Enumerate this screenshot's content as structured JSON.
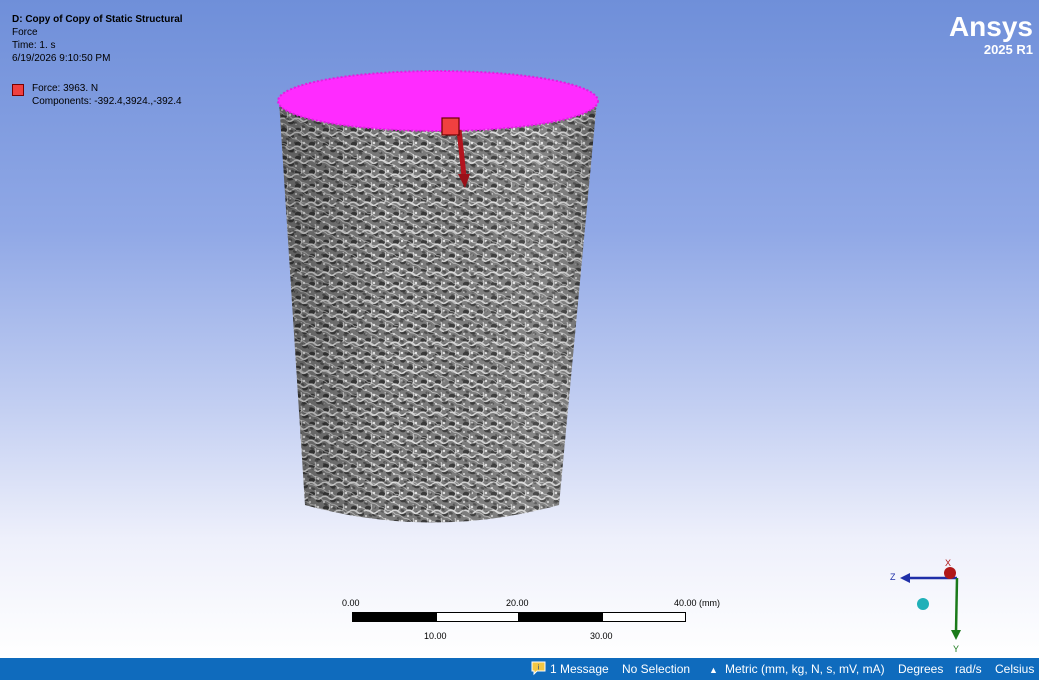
{
  "info": {
    "title": "D: Copy of Copy of Static Structural",
    "type": "Force",
    "time": "Time: 1. s",
    "timestamp": "6/19/2026 9:10:50 PM"
  },
  "legend": {
    "force_label": "Force: 3963. N",
    "components_label": "Components: -392.4,3924.,-392.4",
    "swatch_color": "#f04040"
  },
  "logo": {
    "brand": "Ansys",
    "version": "2025 R1"
  },
  "scale_bar": {
    "top_labels": [
      "0.00",
      "20.00",
      "40.00 (mm)"
    ],
    "bottom_labels": [
      "10.00",
      "30.00"
    ]
  },
  "triad": {
    "x_label": "X",
    "y_label": "Y",
    "z_label": "Z"
  },
  "status": {
    "messages": "1 Message",
    "selection": "No Selection",
    "units": "Metric (mm, kg, N, s, mV, mA)",
    "angle": "Degrees",
    "rotational_velocity": "rad/s",
    "temperature": "Celsius"
  },
  "colors": {
    "load_face": "#ff2bff",
    "force_arrow": "#b3141f",
    "status_bar": "#0f6bbd",
    "model_gray": "#8c8c8c"
  }
}
